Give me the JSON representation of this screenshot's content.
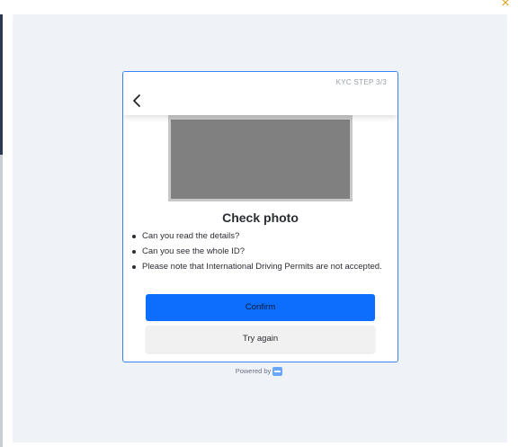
{
  "modal": {
    "close_label": "×"
  },
  "card": {
    "step_label": "KYC STEP 3/3",
    "title": "Check photo",
    "checklist": [
      "Can you read the details?",
      "Can you see the whole ID?",
      "Please note that International Driving Permits are not accepted."
    ],
    "confirm_label": "Confirm",
    "try_again_label": "Try again"
  },
  "footer": {
    "powered_by": "Powered by"
  },
  "colors": {
    "accent": "#0d6efd",
    "close": "#d9a21b",
    "backdrop": "#eff2f7"
  },
  "icons": {
    "back": "chevron-left-icon",
    "close": "close-icon",
    "logo": "brand-logo-icon"
  }
}
